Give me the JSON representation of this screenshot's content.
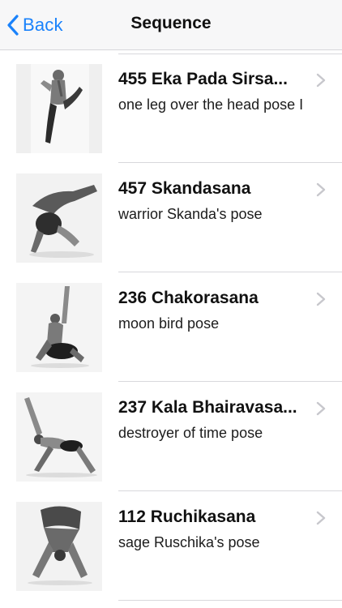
{
  "navbar": {
    "back_label": "Back",
    "title": "Sequence"
  },
  "poses": [
    {
      "title": "455 Eka Pada Sirsa...",
      "subtitle": "one leg over the head pose I",
      "image": "pose-photo"
    },
    {
      "title": "457 Skandasana",
      "subtitle": "warrior Skanda's pose",
      "image": "pose-photo"
    },
    {
      "title": "236 Chakorasana",
      "subtitle": "moon bird pose",
      "image": "pose-photo"
    },
    {
      "title": "237 Kala Bhairavasa...",
      "subtitle": "destroyer of time pose",
      "image": "pose-photo"
    },
    {
      "title": "112 Ruchikasana",
      "subtitle": "sage Ruschika's pose",
      "image": "pose-photo"
    }
  ],
  "icons": {
    "back": "chevron-left-icon",
    "row_disclosure": "chevron-right-icon"
  },
  "colors": {
    "accent": "#1a82fb",
    "navbar_bg": "#f7f7f8",
    "separator": "#d8d8dc",
    "chevron": "#c7c7cc"
  }
}
